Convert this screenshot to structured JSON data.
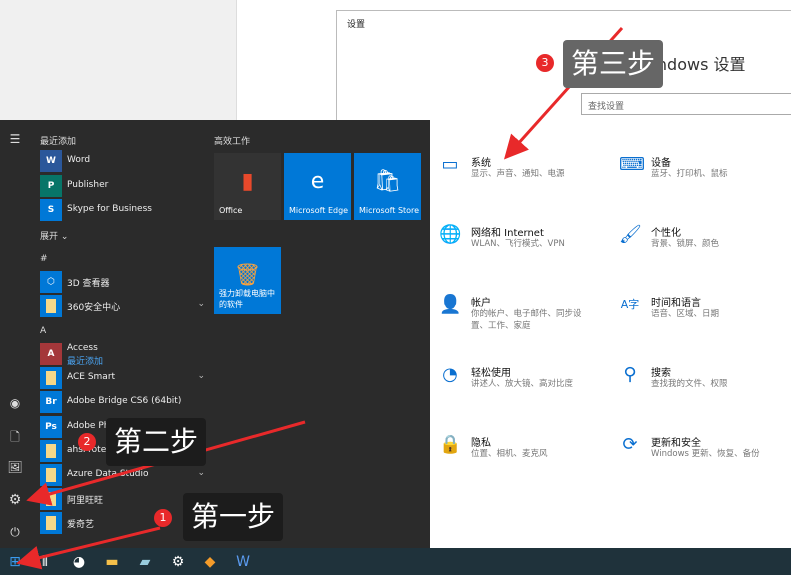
{
  "settings": {
    "window_title": "设置",
    "heading": "Windows 设置",
    "search_placeholder": "查找设置",
    "items": [
      {
        "icon": "laptop-icon",
        "title": "系统",
        "sub": "显示、声音、通知、电源"
      },
      {
        "icon": "devices-icon",
        "title": "设备",
        "sub": "蓝牙、打印机、鼠标"
      },
      {
        "icon": "globe-icon",
        "title": "网络和 Internet",
        "sub": "WLAN、飞行模式、VPN"
      },
      {
        "icon": "personalization-icon",
        "title": "个性化",
        "sub": "背景、锁屏、颜色"
      },
      {
        "icon": "person-icon",
        "title": "帐户",
        "sub": "你的帐户、电子邮件、同步设置、工作、家庭"
      },
      {
        "icon": "time-language-icon",
        "title": "时间和语言",
        "sub": "语音、区域、日期"
      },
      {
        "icon": "ease-of-access-icon",
        "title": "轻松使用",
        "sub": "讲述人、放大镜、高对比度"
      },
      {
        "icon": "search-icon",
        "title": "搜索",
        "sub": "查找我的文件、权限"
      },
      {
        "icon": "lock-icon",
        "title": "隐私",
        "sub": "位置、相机、麦克风"
      },
      {
        "icon": "sync-icon",
        "title": "更新和安全",
        "sub": "Windows 更新、恢复、备份"
      }
    ]
  },
  "start": {
    "recent_header": "最近添加",
    "tiles_header": "高效工作",
    "expand": "展开",
    "hash": "#",
    "letter_a": "A",
    "recent": [
      {
        "name": "Word",
        "badge": "W",
        "color": "#2b579a"
      },
      {
        "name": "Publisher",
        "badge": "P",
        "color": "#077568"
      },
      {
        "name": "Skype for Business",
        "badge": "S",
        "color": "#0078d7"
      }
    ],
    "apps": [
      {
        "name": "3D 查看器",
        "badge": "⬡"
      },
      {
        "name": "360安全中心",
        "folder": true,
        "chev": true
      }
    ],
    "apps_a": [
      {
        "name": "Access",
        "sub": "最近添加",
        "badge": "A",
        "color": "#a4373a"
      },
      {
        "name": "ACE Smart",
        "folder": true,
        "chev": true
      },
      {
        "name": "Adobe Bridge CS6 (64bit)",
        "badge": "Br"
      },
      {
        "name": "Adobe Photoshop CS6 (64 Bit)",
        "badge": "Ps"
      },
      {
        "name": "ahsProtector",
        "folder": true
      },
      {
        "name": "Azure Data Studio",
        "folder": true,
        "chev": true
      },
      {
        "name": "阿里旺旺",
        "folder": true,
        "chev": true
      },
      {
        "name": "爱奇艺",
        "folder": true
      }
    ],
    "tiles": [
      {
        "name": "Office",
        "glyph": "▮"
      },
      {
        "name": "Microsoft Edge",
        "glyph": "e"
      },
      {
        "name": "Microsoft Store",
        "glyph": "🛍"
      },
      {
        "name": "强力卸载电脑中的软件",
        "glyph": "🗑"
      }
    ]
  },
  "annotations": {
    "step1": "第一步",
    "step2": "第二步",
    "step3": "第三步",
    "badge1": "1",
    "badge2": "2",
    "badge3": "3",
    "arrow_color": "#e8292a"
  },
  "colors": {
    "accent": "#0078d7",
    "taskbar": "#1f323b",
    "start_bg": "#2b2b2b"
  }
}
